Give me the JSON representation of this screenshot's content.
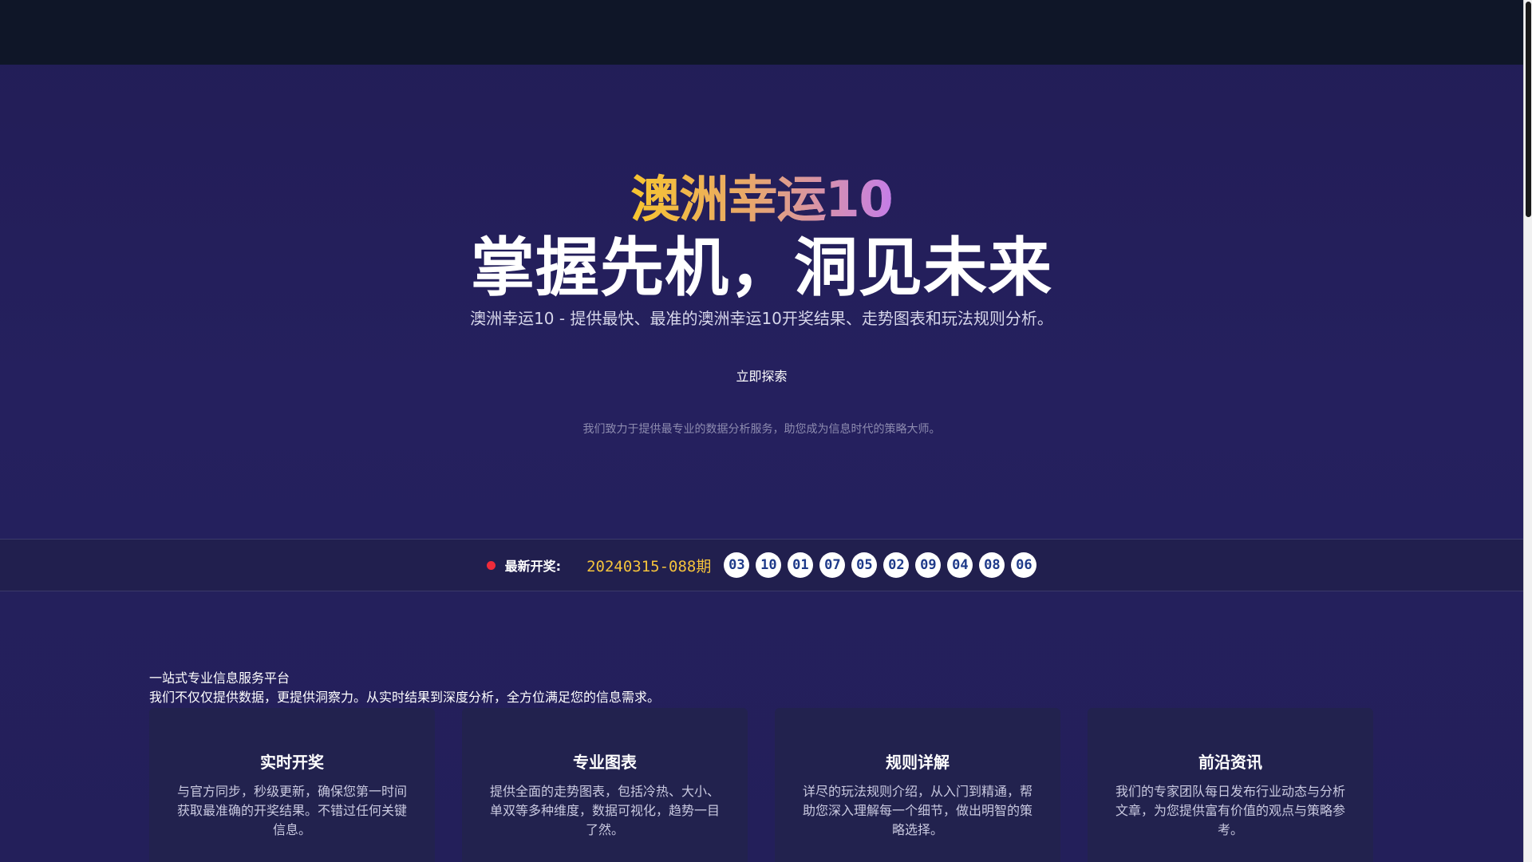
{
  "hero": {
    "brand": "澳洲幸运10",
    "headline": "掌握先机，洞见未来",
    "subtitle": "澳洲幸运10 - 提供最快、最准的澳洲幸运10开奖结果、走势图表和玩法规则分析。",
    "cta_label": "立即探索",
    "tagline": "我们致力于提供最专业的数据分析服务，助您成为信息时代的策略大师。"
  },
  "lottery": {
    "label": "最新开奖:",
    "period": "20240315-088期",
    "numbers": [
      "03",
      "10",
      "01",
      "07",
      "05",
      "02",
      "09",
      "04",
      "08",
      "06"
    ],
    "status_color": "#ef2b3a",
    "period_color": "#f5c33c"
  },
  "intro": {
    "title": "一站式专业信息服务平台",
    "text": "我们不仅仅提供数据，更提供洞察力。从实时结果到深度分析，全方位满足您的信息需求。"
  },
  "features": [
    {
      "title": "实时开奖",
      "desc": "与官方同步，秒级更新，确保您第一时间获取最准确的开奖结果。不错过任何关键信息。"
    },
    {
      "title": "专业图表",
      "desc": "提供全面的走势图表，包括冷热、大小、单双等多种维度，数据可视化，趋势一目了然。"
    },
    {
      "title": "规则详解",
      "desc": "详尽的玩法规则介绍，从入门到精通，帮助您深入理解每一个细节，做出明智的策略选择。"
    },
    {
      "title": "前沿资讯",
      "desc": "我们的专家团队每日发布行业动态与分析文章，为您提供富有价值的观点与策略参考。"
    }
  ],
  "colors": {
    "topbar": "#0f1628",
    "background": "#25205e",
    "accent_gold": "#f5c33c",
    "accent_purple": "#c57de8",
    "ball_text": "#1e3a8a"
  }
}
